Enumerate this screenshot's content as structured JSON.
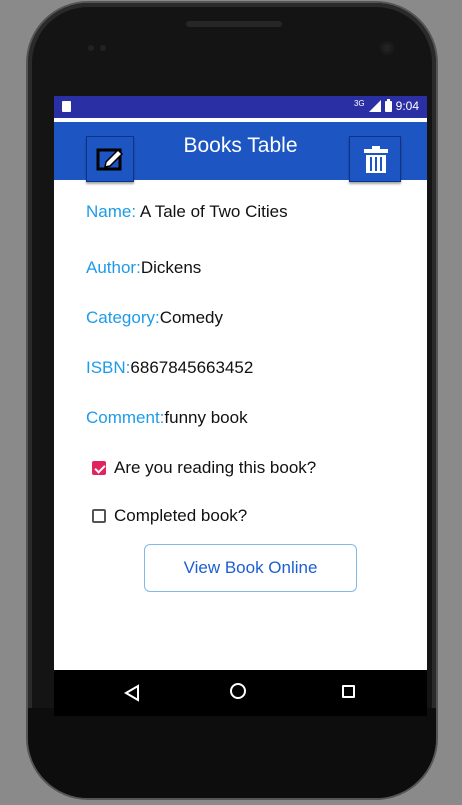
{
  "status_bar": {
    "network": "3G",
    "time": "9:04"
  },
  "app_bar": {
    "title": "Books Table",
    "edit_icon": "edit-icon",
    "delete_icon": "trash-icon"
  },
  "book": {
    "name_label": "Name:",
    "name_value": "A Tale of Two Cities",
    "author_label": "Author:",
    "author_value": "Dickens",
    "category_label": "Category:",
    "category_value": "Comedy",
    "isbn_label": "ISBN:",
    "isbn_value": "6867845663452",
    "comment_label": "Comment:",
    "comment_value": "funny book"
  },
  "checkboxes": {
    "reading_label": "Are you reading this book?",
    "reading_checked": true,
    "completed_label": "Completed book?",
    "completed_checked": false
  },
  "view_button": {
    "label": "View Book Online"
  },
  "colors": {
    "status_bar": "#2b2fa4",
    "app_bar": "#1d56c2",
    "label_blue": "#1e9be8",
    "checkbox_accent": "#e0245e"
  },
  "nav_bar": {
    "icons": [
      "back-icon",
      "home-icon",
      "recents-icon"
    ]
  }
}
